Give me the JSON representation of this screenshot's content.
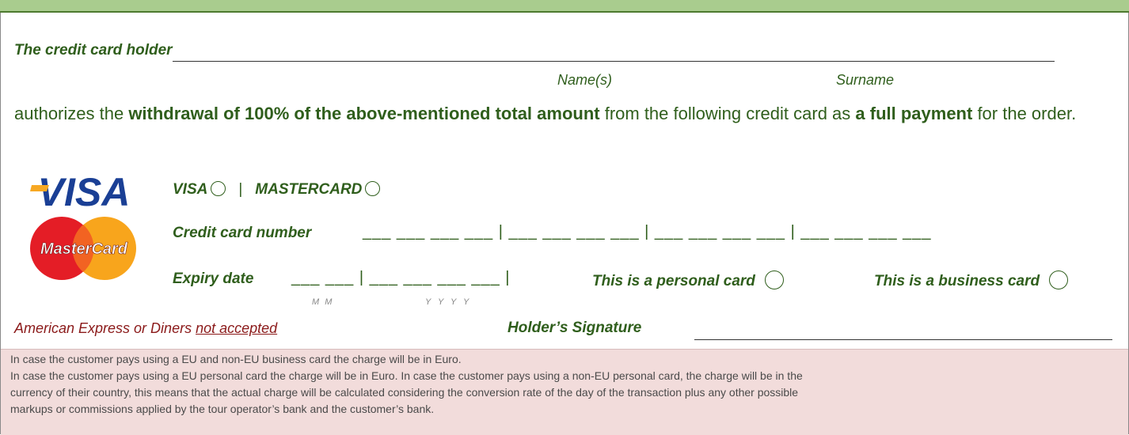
{
  "holder": {
    "label": "The credit card holder",
    "name_caption": "Name(s)",
    "surname_caption": "Surname"
  },
  "authorization": {
    "part1": "authorizes the ",
    "bold1": "withdrawal of 100% of the above-mentioned total amount",
    "part2": " from the following credit card as ",
    "bold2": "a full payment",
    "part3": " for the order."
  },
  "card_types": {
    "visa_label": "VISA",
    "separator": "|",
    "mastercard_label": "MASTERCARD"
  },
  "card_number": {
    "label": "Credit card number",
    "blanks": "___ ___ ___ ___ | ___ ___ ___ ___ | ___ ___ ___ ___ | ___ ___ ___ ___"
  },
  "expiry": {
    "label": "Expiry date",
    "blanks": "___ ___ | ___ ___ ___ ___ |",
    "mm": "M M",
    "yyyy": "Y Y Y Y",
    "personal_label": "This is a personal card",
    "business_label": "This is a business card"
  },
  "restriction": {
    "prefix": "American Express or Diners ",
    "underlined": "not accepted"
  },
  "signature": {
    "label": "Holder’s Signature"
  },
  "logo": {
    "visa_text": "VISA",
    "mastercard_text": "MasterCard"
  },
  "notice": [
    "In case the customer pays using a EU and non-EU business card the charge will be in Euro.",
    "In case the customer pays using a EU personal card the charge will be in Euro. In case the customer pays using a non-EU personal card, the charge will be in the",
    "currency of their country, this means that the actual charge will be calculated considering the conversion rate of the day of the transaction plus any other possible",
    "markups or commissions applied by the tour operator’s bank and the customer’s bank."
  ],
  "colors": {
    "accent_green": "#2f5e1c",
    "bar_green": "#a9cc8e",
    "warning_red": "#8b1a1a",
    "notice_bg": "#f2dcdb"
  }
}
